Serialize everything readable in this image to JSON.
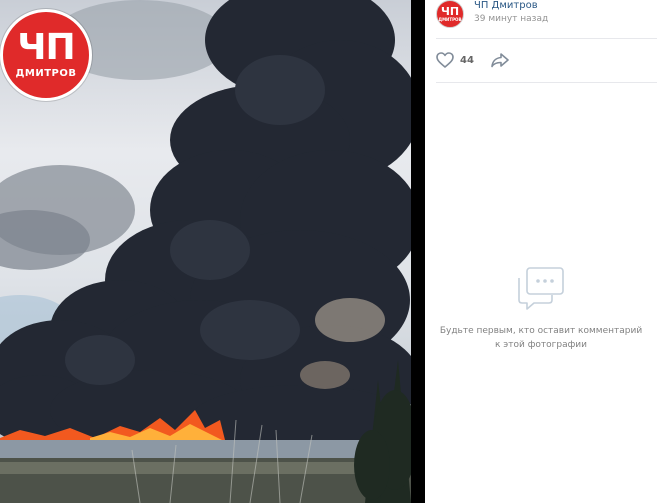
{
  "badge": {
    "big": "ЧП",
    "small": "ДМИТРОВ"
  },
  "post": {
    "avatar_big": "ЧП",
    "avatar_small": "ДМИТРОВ",
    "author": "ЧП Дмитров",
    "timestamp": "39 минут назад"
  },
  "actions": {
    "like_icon": "heart-icon",
    "likes": "44",
    "share_icon": "share-arrow-icon"
  },
  "comments": {
    "icon": "comment-bubble-icon",
    "empty_text": "Будьте первым, кто оставит комментарий к этой фотографии"
  },
  "colors": {
    "brand_red": "#e02a2a",
    "link": "#2a5885",
    "muted": "#939393",
    "fire": "#f2591f"
  }
}
